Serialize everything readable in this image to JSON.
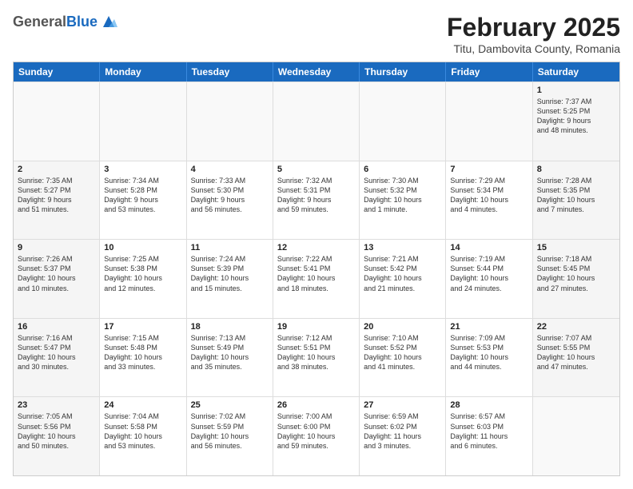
{
  "header": {
    "logo_general": "General",
    "logo_blue": "Blue",
    "month_title": "February 2025",
    "location": "Titu, Dambovita County, Romania"
  },
  "days_of_week": [
    "Sunday",
    "Monday",
    "Tuesday",
    "Wednesday",
    "Thursday",
    "Friday",
    "Saturday"
  ],
  "weeks": [
    [
      {
        "day": "",
        "info": ""
      },
      {
        "day": "",
        "info": ""
      },
      {
        "day": "",
        "info": ""
      },
      {
        "day": "",
        "info": ""
      },
      {
        "day": "",
        "info": ""
      },
      {
        "day": "",
        "info": ""
      },
      {
        "day": "1",
        "info": "Sunrise: 7:37 AM\nSunset: 5:25 PM\nDaylight: 9 hours\nand 48 minutes."
      }
    ],
    [
      {
        "day": "2",
        "info": "Sunrise: 7:35 AM\nSunset: 5:27 PM\nDaylight: 9 hours\nand 51 minutes."
      },
      {
        "day": "3",
        "info": "Sunrise: 7:34 AM\nSunset: 5:28 PM\nDaylight: 9 hours\nand 53 minutes."
      },
      {
        "day": "4",
        "info": "Sunrise: 7:33 AM\nSunset: 5:30 PM\nDaylight: 9 hours\nand 56 minutes."
      },
      {
        "day": "5",
        "info": "Sunrise: 7:32 AM\nSunset: 5:31 PM\nDaylight: 9 hours\nand 59 minutes."
      },
      {
        "day": "6",
        "info": "Sunrise: 7:30 AM\nSunset: 5:32 PM\nDaylight: 10 hours\nand 1 minute."
      },
      {
        "day": "7",
        "info": "Sunrise: 7:29 AM\nSunset: 5:34 PM\nDaylight: 10 hours\nand 4 minutes."
      },
      {
        "day": "8",
        "info": "Sunrise: 7:28 AM\nSunset: 5:35 PM\nDaylight: 10 hours\nand 7 minutes."
      }
    ],
    [
      {
        "day": "9",
        "info": "Sunrise: 7:26 AM\nSunset: 5:37 PM\nDaylight: 10 hours\nand 10 minutes."
      },
      {
        "day": "10",
        "info": "Sunrise: 7:25 AM\nSunset: 5:38 PM\nDaylight: 10 hours\nand 12 minutes."
      },
      {
        "day": "11",
        "info": "Sunrise: 7:24 AM\nSunset: 5:39 PM\nDaylight: 10 hours\nand 15 minutes."
      },
      {
        "day": "12",
        "info": "Sunrise: 7:22 AM\nSunset: 5:41 PM\nDaylight: 10 hours\nand 18 minutes."
      },
      {
        "day": "13",
        "info": "Sunrise: 7:21 AM\nSunset: 5:42 PM\nDaylight: 10 hours\nand 21 minutes."
      },
      {
        "day": "14",
        "info": "Sunrise: 7:19 AM\nSunset: 5:44 PM\nDaylight: 10 hours\nand 24 minutes."
      },
      {
        "day": "15",
        "info": "Sunrise: 7:18 AM\nSunset: 5:45 PM\nDaylight: 10 hours\nand 27 minutes."
      }
    ],
    [
      {
        "day": "16",
        "info": "Sunrise: 7:16 AM\nSunset: 5:47 PM\nDaylight: 10 hours\nand 30 minutes."
      },
      {
        "day": "17",
        "info": "Sunrise: 7:15 AM\nSunset: 5:48 PM\nDaylight: 10 hours\nand 33 minutes."
      },
      {
        "day": "18",
        "info": "Sunrise: 7:13 AM\nSunset: 5:49 PM\nDaylight: 10 hours\nand 35 minutes."
      },
      {
        "day": "19",
        "info": "Sunrise: 7:12 AM\nSunset: 5:51 PM\nDaylight: 10 hours\nand 38 minutes."
      },
      {
        "day": "20",
        "info": "Sunrise: 7:10 AM\nSunset: 5:52 PM\nDaylight: 10 hours\nand 41 minutes."
      },
      {
        "day": "21",
        "info": "Sunrise: 7:09 AM\nSunset: 5:53 PM\nDaylight: 10 hours\nand 44 minutes."
      },
      {
        "day": "22",
        "info": "Sunrise: 7:07 AM\nSunset: 5:55 PM\nDaylight: 10 hours\nand 47 minutes."
      }
    ],
    [
      {
        "day": "23",
        "info": "Sunrise: 7:05 AM\nSunset: 5:56 PM\nDaylight: 10 hours\nand 50 minutes."
      },
      {
        "day": "24",
        "info": "Sunrise: 7:04 AM\nSunset: 5:58 PM\nDaylight: 10 hours\nand 53 minutes."
      },
      {
        "day": "25",
        "info": "Sunrise: 7:02 AM\nSunset: 5:59 PM\nDaylight: 10 hours\nand 56 minutes."
      },
      {
        "day": "26",
        "info": "Sunrise: 7:00 AM\nSunset: 6:00 PM\nDaylight: 10 hours\nand 59 minutes."
      },
      {
        "day": "27",
        "info": "Sunrise: 6:59 AM\nSunset: 6:02 PM\nDaylight: 11 hours\nand 3 minutes."
      },
      {
        "day": "28",
        "info": "Sunrise: 6:57 AM\nSunset: 6:03 PM\nDaylight: 11 hours\nand 6 minutes."
      },
      {
        "day": "",
        "info": ""
      }
    ]
  ]
}
